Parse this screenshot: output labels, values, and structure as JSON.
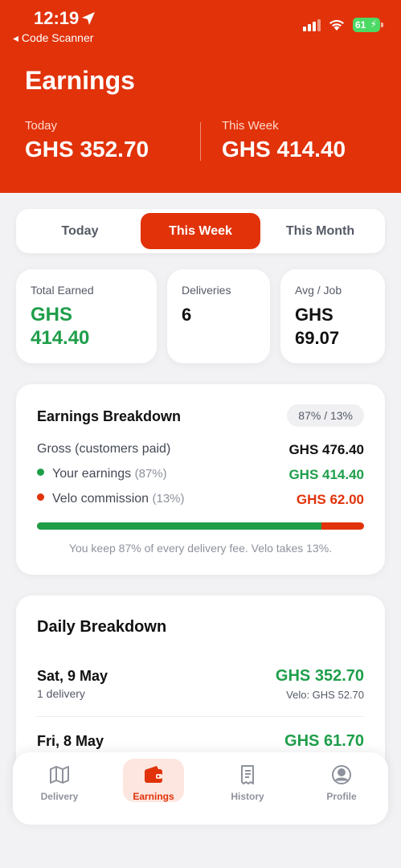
{
  "status_bar": {
    "time": "12:19",
    "back_app": "◂ Code Scanner",
    "battery": "61"
  },
  "header": {
    "title": "Earnings",
    "today_label": "Today",
    "today_value": "GHS 352.70",
    "week_label": "This Week",
    "week_value": "GHS 414.40"
  },
  "segments": {
    "today": "Today",
    "week": "This Week",
    "month": "This Month",
    "selected": "This Week"
  },
  "summary": {
    "total_label": "Total Earned",
    "total_value_line1": "GHS",
    "total_value_line2": "414.40",
    "deliveries_label": "Deliveries",
    "deliveries_value": "6",
    "avg_label": "Avg / Job",
    "avg_value_line1": "GHS",
    "avg_value_line2": "69.07"
  },
  "breakdown": {
    "title": "Earnings Breakdown",
    "ratio_pill": "87% / 13%",
    "gross_label": "Gross (customers paid)",
    "gross_value": "GHS 476.40",
    "earn_label": "Your earnings",
    "earn_pct": "(87%)",
    "earn_value": "GHS 414.40",
    "comm_label": "Velo commission",
    "comm_pct": "(13%)",
    "comm_value": "GHS 62.00",
    "earn_share": 0.87,
    "note": "You keep 87% of every delivery fee. Velo takes 13%."
  },
  "daily": {
    "title": "Daily Breakdown",
    "days": [
      {
        "name": "Sat, 9 May",
        "sub": "1 delivery",
        "amount": "GHS 352.70",
        "fee": "Velo: GHS 52.70"
      },
      {
        "name": "Fri, 8 May",
        "amount": "GHS 61.70"
      }
    ]
  },
  "tabbar": {
    "tabs": [
      {
        "label": "Delivery",
        "icon": "map-icon"
      },
      {
        "label": "Earnings",
        "icon": "wallet-icon"
      },
      {
        "label": "History",
        "icon": "receipt-icon"
      },
      {
        "label": "Profile",
        "icon": "profile-icon"
      }
    ],
    "active": "Earnings"
  },
  "colors": {
    "brand": "#e1320a",
    "positive": "#1f9e4a",
    "muted": "#8e929c"
  }
}
